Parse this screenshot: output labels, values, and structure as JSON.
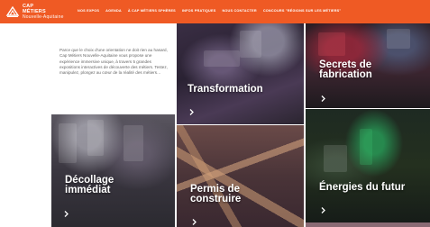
{
  "header": {
    "logo_line1": "CAP",
    "logo_line2": "MÉTIERS",
    "logo_line3": "Nouvelle-Aquitaine",
    "accent": "#ef5a24",
    "nav": [
      "NOS EXPOS",
      "AGENDA",
      "À CAP MÉTIERS SPHÈRES",
      "INFOS PRATIQUES",
      "NOUS CONTACTER",
      "CONCOURS \"RÉGIONS SUR LES MÉTIERS\""
    ]
  },
  "intro": {
    "text": "Parce que le choix d'une orientation ne doit rien au hasard, Cap Métiers Nouvelle-Aquitaine vous propose une expérience immersive unique, à travers 5 grandes expositions interactives de découverte des métiers. Testez, manipulez, plongez au cœur de la réalité des métiers…"
  },
  "tiles": {
    "transformation": {
      "title": "Transformation",
      "arrow": "chevron-right-icon"
    },
    "secrets": {
      "title": "Secrets de fabrication",
      "arrow": "chevron-right-icon"
    },
    "decollage": {
      "title": "Décollage immédiat",
      "arrow": "chevron-right-icon"
    },
    "permis": {
      "title": "Permis de construire",
      "arrow": "chevron-right-icon"
    },
    "energies": {
      "title": "Énergies du futur",
      "arrow": "chevron-right-icon"
    }
  }
}
